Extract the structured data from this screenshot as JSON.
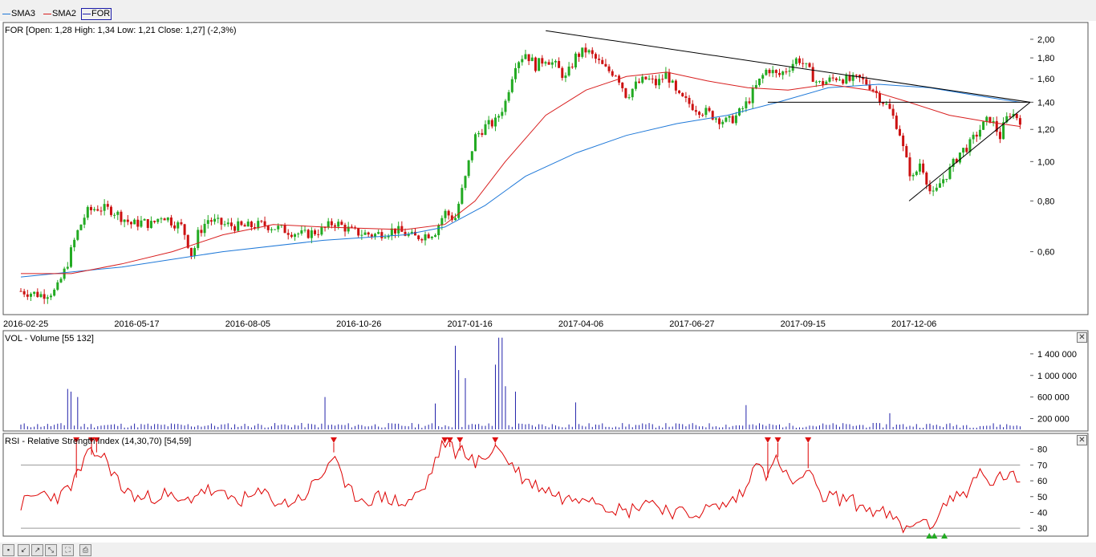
{
  "legend": [
    {
      "label": "SMA3",
      "color": "#1e78d8"
    },
    {
      "label": "SMA2",
      "color": "#d81e1e"
    },
    {
      "label": "FOR",
      "color": "#1a1aa8"
    }
  ],
  "panels": {
    "price": {
      "title": "FOR [Open: 1,28  High: 1,34  Low: 1,21  Close: 1,27] (-2,3%)"
    },
    "volume": {
      "title": "VOL - Volume [55 132]"
    },
    "rsi": {
      "title": "RSI - Relative Strength Index (14,30,70) [54,59]"
    }
  },
  "toolbar": {
    "buttons": [
      "save-icon",
      "zoom-in-icon",
      "zoom-out-icon",
      "zoom-reset-icon",
      "fit-icon",
      "print-icon"
    ]
  },
  "colors": {
    "up_candle": "#22aa22",
    "down_candle": "#cc1111",
    "sma3": "#1e78d8",
    "sma2": "#d81e1e",
    "volume": "#2222aa",
    "rsi": "#dd0000",
    "trendline": "#000000",
    "grid": "#c8c8c8"
  },
  "chart_data": [
    {
      "type": "candlestick",
      "title": "FOR [Open: 1,28  High: 1,34  Low: 1,21  Close: 1,27] (-2,3%)",
      "scale": "log",
      "ylim": [
        0.42,
        2.2
      ],
      "y_ticks": [
        "2,00",
        "1,80",
        "1,60",
        "1,40",
        "1,20",
        "1,00",
        "0,80",
        "0,60"
      ],
      "y_tick_values": [
        2.0,
        1.8,
        1.6,
        1.4,
        1.2,
        1.0,
        0.8,
        0.6
      ],
      "x_ticks": [
        "2016-02-25",
        "2016-05-17",
        "2016-08-05",
        "2016-10-26",
        "2017-01-16",
        "2017-04-06",
        "2017-06-27",
        "2017-09-15",
        "2017-12-06"
      ],
      "last": {
        "open": 1.28,
        "high": 1.34,
        "low": 1.21,
        "close": 1.27,
        "change_pct": -2.3
      },
      "close_path": [
        [
          0,
          0.48
        ],
        [
          0.02,
          0.47
        ],
        [
          0.035,
          0.48
        ],
        [
          0.045,
          0.55
        ],
        [
          0.055,
          0.66
        ],
        [
          0.065,
          0.75
        ],
        [
          0.075,
          0.77
        ],
        [
          0.09,
          0.76
        ],
        [
          0.1,
          0.73
        ],
        [
          0.11,
          0.7
        ],
        [
          0.12,
          0.71
        ],
        [
          0.13,
          0.7
        ],
        [
          0.14,
          0.74
        ],
        [
          0.15,
          0.71
        ],
        [
          0.16,
          0.69
        ],
        [
          0.17,
          0.58
        ],
        [
          0.175,
          0.66
        ],
        [
          0.185,
          0.72
        ],
        [
          0.2,
          0.7
        ],
        [
          0.22,
          0.69
        ],
        [
          0.24,
          0.7
        ],
        [
          0.26,
          0.68
        ],
        [
          0.28,
          0.66
        ],
        [
          0.3,
          0.68
        ],
        [
          0.31,
          0.71
        ],
        [
          0.33,
          0.67
        ],
        [
          0.35,
          0.66
        ],
        [
          0.37,
          0.68
        ],
        [
          0.39,
          0.65
        ],
        [
          0.41,
          0.67
        ],
        [
          0.42,
          0.75
        ],
        [
          0.43,
          0.72
        ],
        [
          0.44,
          0.9
        ],
        [
          0.45,
          1.15
        ],
        [
          0.46,
          1.22
        ],
        [
          0.47,
          1.25
        ],
        [
          0.48,
          1.4
        ],
        [
          0.49,
          1.75
        ],
        [
          0.5,
          1.85
        ],
        [
          0.51,
          1.72
        ],
        [
          0.52,
          1.8
        ],
        [
          0.53,
          1.72
        ],
        [
          0.54,
          1.6
        ],
        [
          0.55,
          1.82
        ],
        [
          0.56,
          1.88
        ],
        [
          0.57,
          1.78
        ],
        [
          0.58,
          1.68
        ],
        [
          0.59,
          1.65
        ],
        [
          0.6,
          1.45
        ],
        [
          0.61,
          1.55
        ],
        [
          0.62,
          1.6
        ],
        [
          0.63,
          1.55
        ],
        [
          0.64,
          1.65
        ],
        [
          0.65,
          1.45
        ],
        [
          0.66,
          1.4
        ],
        [
          0.67,
          1.35
        ],
        [
          0.68,
          1.32
        ],
        [
          0.69,
          1.28
        ],
        [
          0.7,
          1.25
        ],
        [
          0.71,
          1.3
        ],
        [
          0.72,
          1.4
        ],
        [
          0.73,
          1.55
        ],
        [
          0.74,
          1.7
        ],
        [
          0.75,
          1.62
        ],
        [
          0.76,
          1.7
        ],
        [
          0.77,
          1.8
        ],
        [
          0.78,
          1.68
        ],
        [
          0.79,
          1.55
        ],
        [
          0.8,
          1.58
        ],
        [
          0.81,
          1.62
        ],
        [
          0.82,
          1.58
        ],
        [
          0.83,
          1.6
        ],
        [
          0.84,
          1.55
        ],
        [
          0.85,
          1.45
        ],
        [
          0.86,
          1.35
        ],
        [
          0.87,
          1.2
        ],
        [
          0.875,
          1.05
        ],
        [
          0.88,
          0.95
        ],
        [
          0.885,
          0.9
        ],
        [
          0.89,
          1.0
        ],
        [
          0.895,
          0.95
        ],
        [
          0.9,
          0.85
        ],
        [
          0.905,
          0.82
        ],
        [
          0.91,
          0.88
        ],
        [
          0.92,
          0.95
        ],
        [
          0.93,
          1.05
        ],
        [
          0.94,
          1.1
        ],
        [
          0.95,
          1.2
        ],
        [
          0.96,
          1.28
        ],
        [
          0.965,
          1.22
        ],
        [
          0.97,
          1.15
        ],
        [
          0.975,
          1.25
        ],
        [
          0.98,
          1.32
        ],
        [
          0.985,
          1.3
        ],
        [
          0.99,
          1.27
        ]
      ],
      "sma3_path": [
        [
          0,
          0.52
        ],
        [
          0.1,
          0.55
        ],
        [
          0.2,
          0.6
        ],
        [
          0.3,
          0.64
        ],
        [
          0.38,
          0.66
        ],
        [
          0.42,
          0.69
        ],
        [
          0.46,
          0.78
        ],
        [
          0.5,
          0.92
        ],
        [
          0.55,
          1.05
        ],
        [
          0.6,
          1.16
        ],
        [
          0.65,
          1.24
        ],
        [
          0.7,
          1.3
        ],
        [
          0.75,
          1.4
        ],
        [
          0.8,
          1.52
        ],
        [
          0.85,
          1.55
        ],
        [
          0.9,
          1.52
        ],
        [
          0.95,
          1.45
        ],
        [
          0.99,
          1.4
        ]
      ],
      "sma2_path": [
        [
          0,
          0.53
        ],
        [
          0.05,
          0.53
        ],
        [
          0.1,
          0.56
        ],
        [
          0.15,
          0.6
        ],
        [
          0.2,
          0.66
        ],
        [
          0.25,
          0.7
        ],
        [
          0.3,
          0.69
        ],
        [
          0.38,
          0.68
        ],
        [
          0.42,
          0.7
        ],
        [
          0.45,
          0.8
        ],
        [
          0.48,
          1.0
        ],
        [
          0.52,
          1.3
        ],
        [
          0.56,
          1.5
        ],
        [
          0.6,
          1.62
        ],
        [
          0.64,
          1.66
        ],
        [
          0.68,
          1.58
        ],
        [
          0.72,
          1.52
        ],
        [
          0.76,
          1.5
        ],
        [
          0.8,
          1.55
        ],
        [
          0.84,
          1.5
        ],
        [
          0.88,
          1.4
        ],
        [
          0.92,
          1.3
        ],
        [
          0.96,
          1.25
        ],
        [
          0.99,
          1.22
        ]
      ],
      "trendlines": [
        {
          "from": [
            0.52,
            2.1
          ],
          "to": [
            1.0,
            1.4
          ]
        },
        {
          "from": [
            0.74,
            1.4
          ],
          "to": [
            1.0,
            1.4
          ]
        },
        {
          "from": [
            0.88,
            0.8
          ],
          "to": [
            1.0,
            1.4
          ]
        }
      ]
    },
    {
      "type": "bar",
      "title": "VOL - Volume [55 132]",
      "ylim": [
        0,
        1800000
      ],
      "y_ticks": [
        "1 400 000",
        "1 000 000",
        "600 000",
        "200 000"
      ],
      "y_tick_values": [
        1400000,
        1000000,
        600000,
        200000
      ],
      "spikes": [
        [
          0.045,
          750000
        ],
        [
          0.05,
          700000
        ],
        [
          0.055,
          600000
        ],
        [
          0.3,
          600000
        ],
        [
          0.41,
          480000
        ],
        [
          0.43,
          1550000
        ],
        [
          0.435,
          1100000
        ],
        [
          0.44,
          950000
        ],
        [
          0.47,
          1200000
        ],
        [
          0.475,
          1700000
        ],
        [
          0.48,
          800000
        ],
        [
          0.49,
          700000
        ],
        [
          0.55,
          500000
        ],
        [
          0.72,
          450000
        ],
        [
          0.86,
          300000
        ]
      ]
    },
    {
      "type": "line",
      "title": "RSI - Relative Strength Index (14,30,70) [54,59]",
      "ylim": [
        25,
        90
      ],
      "y_ticks": [
        "80",
        "70",
        "60",
        "50",
        "40",
        "30"
      ],
      "y_tick_values": [
        80,
        70,
        60,
        50,
        40,
        30
      ],
      "levels": [
        30,
        70
      ],
      "path": [
        [
          0,
          45
        ],
        [
          0.02,
          52
        ],
        [
          0.04,
          50
        ],
        [
          0.055,
          62
        ],
        [
          0.065,
          75
        ],
        [
          0.075,
          78
        ],
        [
          0.085,
          73
        ],
        [
          0.1,
          55
        ],
        [
          0.12,
          48
        ],
        [
          0.14,
          52
        ],
        [
          0.16,
          45
        ],
        [
          0.18,
          55
        ],
        [
          0.2,
          50
        ],
        [
          0.22,
          48
        ],
        [
          0.24,
          52
        ],
        [
          0.26,
          45
        ],
        [
          0.28,
          50
        ],
        [
          0.3,
          65
        ],
        [
          0.31,
          78
        ],
        [
          0.32,
          55
        ],
        [
          0.34,
          48
        ],
        [
          0.36,
          50
        ],
        [
          0.38,
          45
        ],
        [
          0.4,
          55
        ],
        [
          0.41,
          72
        ],
        [
          0.42,
          85
        ],
        [
          0.43,
          78
        ],
        [
          0.44,
          80
        ],
        [
          0.45,
          70
        ],
        [
          0.46,
          75
        ],
        [
          0.47,
          82
        ],
        [
          0.48,
          75
        ],
        [
          0.5,
          60
        ],
        [
          0.52,
          55
        ],
        [
          0.54,
          48
        ],
        [
          0.56,
          52
        ],
        [
          0.58,
          45
        ],
        [
          0.6,
          40
        ],
        [
          0.62,
          48
        ],
        [
          0.64,
          42
        ],
        [
          0.66,
          38
        ],
        [
          0.68,
          42
        ],
        [
          0.7,
          45
        ],
        [
          0.72,
          55
        ],
        [
          0.73,
          78
        ],
        [
          0.74,
          62
        ],
        [
          0.75,
          75
        ],
        [
          0.76,
          60
        ],
        [
          0.77,
          58
        ],
        [
          0.78,
          68
        ],
        [
          0.79,
          50
        ],
        [
          0.8,
          50
        ],
        [
          0.82,
          48
        ],
        [
          0.84,
          42
        ],
        [
          0.86,
          38
        ],
        [
          0.87,
          32
        ],
        [
          0.88,
          28
        ],
        [
          0.89,
          38
        ],
        [
          0.9,
          28
        ],
        [
          0.91,
          42
        ],
        [
          0.92,
          48
        ],
        [
          0.94,
          55
        ],
        [
          0.95,
          65
        ],
        [
          0.96,
          58
        ],
        [
          0.97,
          62
        ],
        [
          0.98,
          65
        ],
        [
          0.99,
          55
        ]
      ],
      "overbought_markers": [
        0.055,
        0.07,
        0.075,
        0.31,
        0.42,
        0.425,
        0.435,
        0.47,
        0.74,
        0.75,
        0.78
      ],
      "oversold_markers": [
        0.9,
        0.905,
        0.915
      ]
    }
  ]
}
